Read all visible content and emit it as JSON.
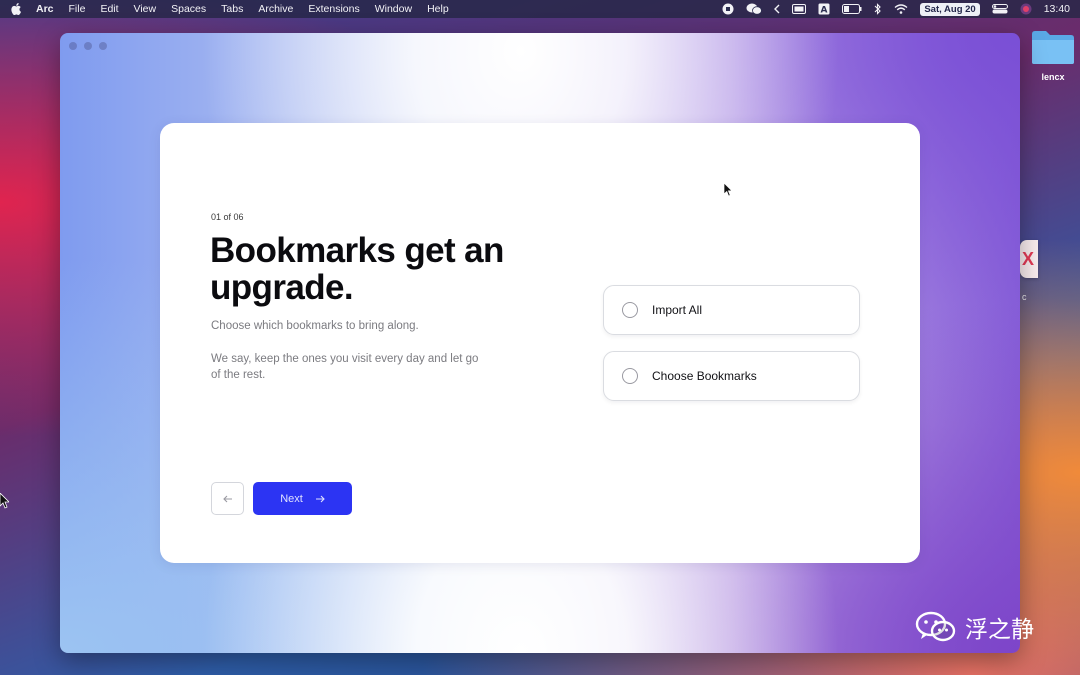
{
  "menubar": {
    "app_name": "Arc",
    "items": [
      "File",
      "Edit",
      "View",
      "Spaces",
      "Tabs",
      "Archive",
      "Extensions",
      "Window",
      "Help"
    ],
    "date": "Sat, Aug 20",
    "time": "13:40",
    "icons": [
      "apple-icon",
      "record-icon",
      "wechat-icon",
      "chevron-left-icon",
      "battery-level-icon",
      "keyboard-a-icon",
      "battery-icon",
      "bluetooth-icon",
      "wifi-icon",
      "control-center-icon",
      "siri-icon"
    ]
  },
  "desktop": {
    "folder_label": "lencx",
    "app_peek_label": "c"
  },
  "onboarding": {
    "step": "01 of 06",
    "headline": "Bookmarks get an upgrade.",
    "subtitle": "Choose which bookmarks to bring along.",
    "body": "We say, keep the ones you visit every day and let go of the rest.",
    "options": [
      {
        "label": "Import All",
        "selected": false
      },
      {
        "label": "Choose Bookmarks",
        "selected": false
      }
    ],
    "next_label": "Next",
    "colors": {
      "accent": "#2c34f3",
      "card": "#ffffff"
    }
  },
  "watermark": {
    "text": "浮之静"
  }
}
